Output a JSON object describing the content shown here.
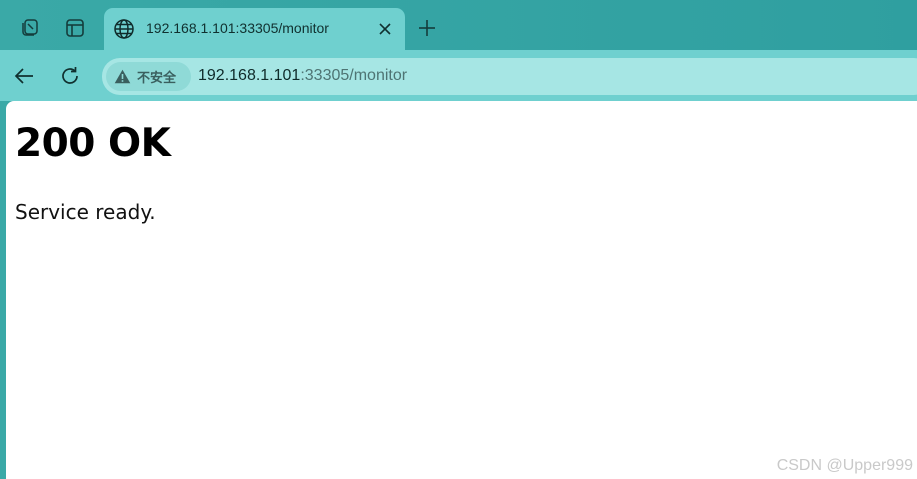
{
  "tabs": [
    {
      "title": "192.168.1.101:33305/monitor",
      "favicon": "globe-icon",
      "active": true
    }
  ],
  "toolbar": {
    "security_label": "不安全",
    "url_host": "192.168.1.101",
    "url_rest": ":33305/monitor"
  },
  "page": {
    "heading": "200 OK",
    "message": "Service ready."
  },
  "watermark": "CSDN @Upper999",
  "colors": {
    "tabstrip": "#3aa9a7",
    "toolbar": "#6fd0cf",
    "omnibox": "#a6e6e4",
    "content": "#ffffff"
  },
  "icons": [
    "workspaces-icon",
    "tab-actions-icon",
    "globe-icon",
    "close-icon",
    "plus-icon",
    "back-arrow-icon",
    "reload-icon",
    "warning-icon"
  ]
}
